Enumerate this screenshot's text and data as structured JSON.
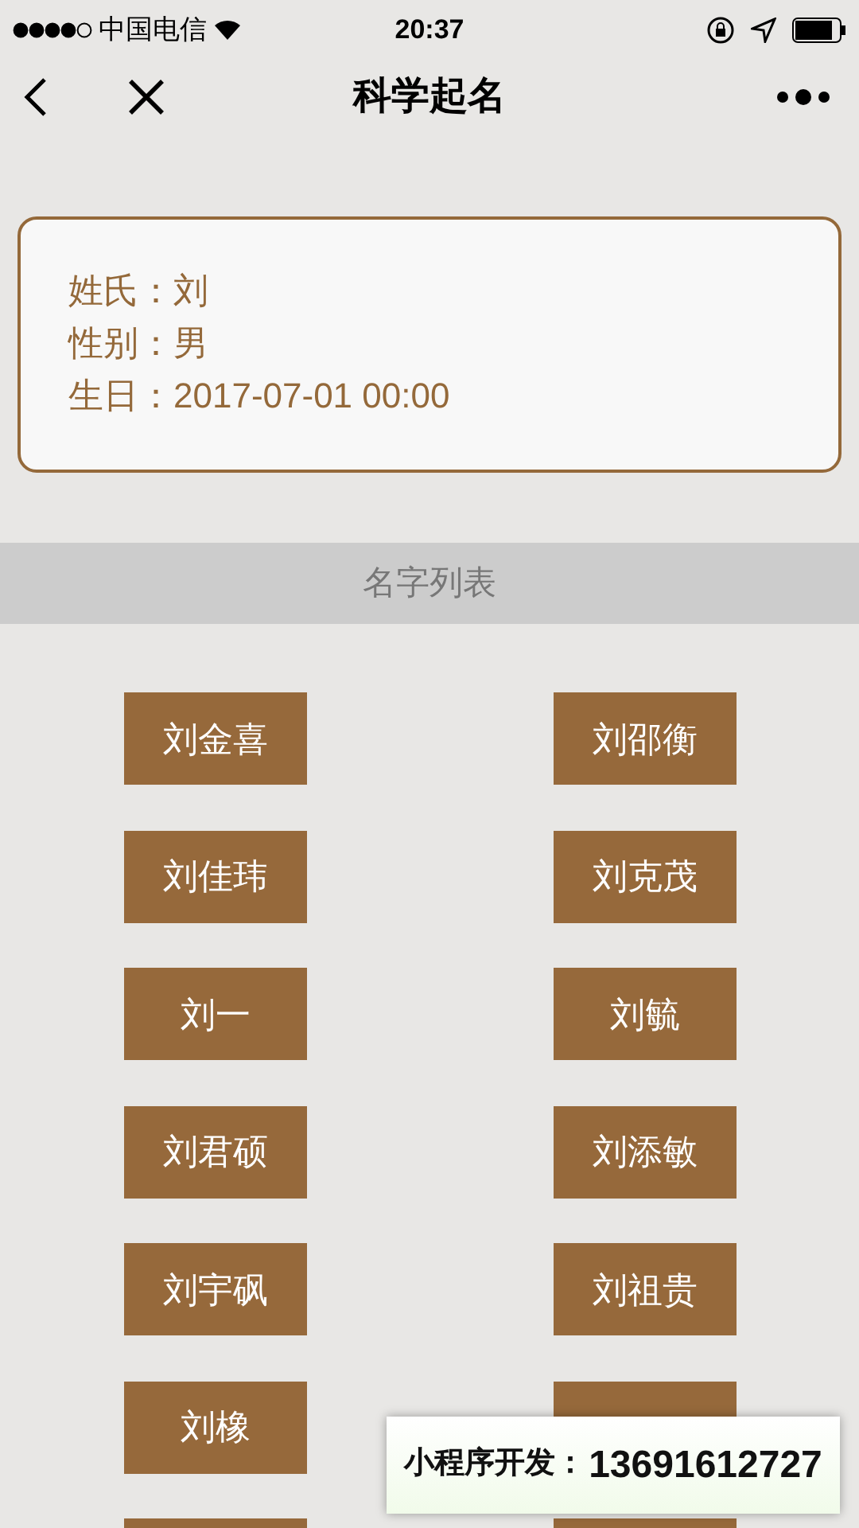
{
  "status_bar": {
    "carrier": "中国电信",
    "time": "20:37"
  },
  "nav": {
    "title": "科学起名"
  },
  "info": [
    {
      "label": "姓氏：",
      "value": "刘"
    },
    {
      "label": "性别：",
      "value": "男"
    },
    {
      "label": "生日：",
      "value": "2017-07-01 00:00"
    }
  ],
  "section": {
    "title": "名字列表"
  },
  "names": [
    {
      "kind": "name",
      "label": "刘金喜"
    },
    {
      "kind": "name",
      "label": "刘邵衡"
    },
    {
      "kind": "name",
      "label": "刘佳玮"
    },
    {
      "kind": "name",
      "label": "刘克茂"
    },
    {
      "kind": "name",
      "label": "刘一"
    },
    {
      "kind": "name",
      "label": "刘毓"
    },
    {
      "kind": "name",
      "label": "刘君硕"
    },
    {
      "kind": "name",
      "label": "刘添敏"
    },
    {
      "kind": "name",
      "label": "刘宇砜"
    },
    {
      "kind": "name",
      "label": "刘祖贵"
    },
    {
      "kind": "name",
      "label": "刘橡"
    },
    {
      "kind": "covered"
    },
    {
      "kind": "covered"
    },
    {
      "kind": "covered"
    }
  ],
  "overlay": {
    "label": "小程序开发：",
    "phone": "13691612727"
  }
}
